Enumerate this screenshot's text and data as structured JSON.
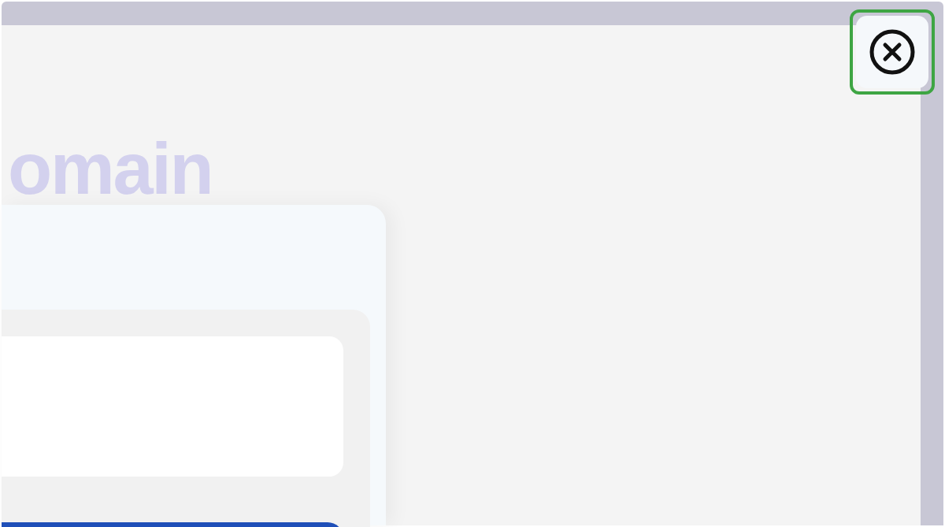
{
  "heading": {
    "text": "omain"
  },
  "close_button": {
    "highlighted": true
  }
}
